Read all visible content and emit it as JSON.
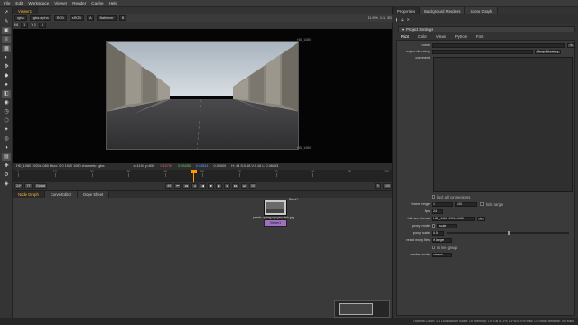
{
  "menu": [
    "File",
    "Edit",
    "Workspace",
    "Viewer",
    "Render",
    "Cache",
    "Help"
  ],
  "toolbar_icons": [
    "pointer-icon",
    "brush-icon",
    "image-icon",
    "layers-icon",
    "grid-icon",
    "merge-icon",
    "transform-icon",
    "filter-icon",
    "keyer-icon",
    "color-icon",
    "channel-icon",
    "time-icon",
    "3d-icon",
    "particle-icon",
    "deep-icon",
    "view-icon",
    "metadata-icon",
    "other-icon",
    "plugin-icon",
    "python-icon"
  ],
  "viewer": {
    "tab": "Viewer1",
    "channels": "rgba",
    "alpha": "rgba.alpha",
    "colorspace": "RGB",
    "lut": "sRGB",
    "gain_label": "f/8",
    "gamma_label": "Y 1",
    "exposure": "1",
    "zoom": "51.9%",
    "ratio": "1:1",
    "downrez": "2D",
    "input_a": "A",
    "input_b": "B",
    "blend": "Bafnimer",
    "frame_label": "1",
    "image_name_top": "HD_1080",
    "image_name_bottom": "HD_1080"
  },
  "infobar": {
    "format": "HD_1080 1920x1080  bbox: 0 0 1920 1080 channels: rgba",
    "coords": "x=1194 y=655",
    "r": "0.15790",
    "g": "0.05455",
    "b": "0.04541",
    "a": "0.00000",
    "hsv": "H: 44 S:0.18 V:0.16  L: 0.06463"
  },
  "timeline": {
    "ticks": [
      "1",
      "10",
      "20",
      "30",
      "40",
      "50",
      "60",
      "70",
      "80",
      "90",
      "100"
    ],
    "current_frame": "49",
    "fps": "24*",
    "tf": "TF",
    "global": "Global",
    "end_frame": "100",
    "step": "10"
  },
  "nodegraph": {
    "tabs": [
      "Node Graph",
      "Curve Editor",
      "Dope Sheet"
    ],
    "read_node": "Read1",
    "read_sublabel": "pexels-quang-nguyen-vinh.jpg",
    "viewer_node": "Viewer1"
  },
  "statusbar": "Channel Count: 21  Localization Mode: On  Memory: 1.9 GB (6.1%)  CPU: 0.0%  Disk: 0.0 MB/s  Network: 0.0 MB/s",
  "right_panel": {
    "tabs": [
      "Properties",
      "Background Renders",
      "Scene Graph"
    ],
    "settings_title": "Project Settings",
    "settings_tabs": [
      "Root",
      "Color",
      "Views",
      "Python",
      "Font"
    ],
    "name_label": "name",
    "project_dir_label": "project directory",
    "script_dir_button": "Script Directory",
    "comment_label": "comment",
    "lock_connections": "lock all connections",
    "frame_range_label": "frame range",
    "frame_start": "1",
    "frame_end": "100",
    "lock_range": "lock range",
    "fps_label": "fps",
    "fps_value": "24",
    "full_size_label": "full size format",
    "full_size_value": "HD_1080 1920x1080",
    "proxy_mode_label": "proxy mode",
    "proxy_mode_value": "scale",
    "proxy_scale_label": "proxy scale",
    "proxy_scale_value": "0.5",
    "read_proxy_label": "read proxy files",
    "read_proxy_value": "if larger",
    "live_group": "is live group",
    "render_mode_label": "render mode",
    "render_mode_value": "classic"
  }
}
